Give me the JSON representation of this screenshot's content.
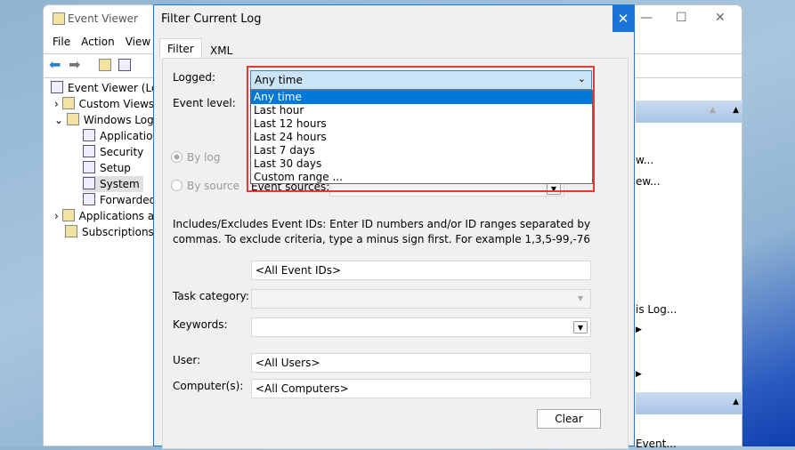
{
  "event_viewer": {
    "title": "Event Viewer",
    "menu": [
      "File",
      "Action",
      "View"
    ],
    "tree": [
      {
        "label": "Event Viewer (Loca"
      },
      {
        "label": "Custom Views"
      },
      {
        "label": "Windows Logs"
      },
      {
        "label": "Application"
      },
      {
        "label": "Security"
      },
      {
        "label": "Setup"
      },
      {
        "label": "System"
      },
      {
        "label": "Forwarded"
      },
      {
        "label": "Applications ar"
      },
      {
        "label": "Subscriptions"
      }
    ],
    "actions": [
      "w...",
      "ew...",
      "",
      "is Log...",
      "Event..."
    ]
  },
  "dialog": {
    "title": "Filter Current Log",
    "close": "✕",
    "tabs": [
      "Filter",
      "XML"
    ],
    "logged_label": "Logged:",
    "logged_value": "Any time",
    "logged_options": [
      "Any time",
      "Last hour",
      "Last 12 hours",
      "Last 24 hours",
      "Last 7 days",
      "Last 30 days",
      "Custom range ..."
    ],
    "event_level_label": "Event level:",
    "by_log": "By log",
    "by_source": "By source",
    "event_sources_label": "Event sources:",
    "ids_help": "Includes/Excludes Event IDs: Enter ID numbers and/or ID ranges separated by commas. To exclude criteria, type a minus sign first. For example 1,3,5-99,-76",
    "event_ids": "<All Event IDs>",
    "task_category_label": "Task category:",
    "keywords_label": "Keywords:",
    "user_label": "User:",
    "user_value": "<All Users>",
    "computer_label": "Computer(s):",
    "computer_value": "<All Computers>",
    "clear": "Clear"
  }
}
